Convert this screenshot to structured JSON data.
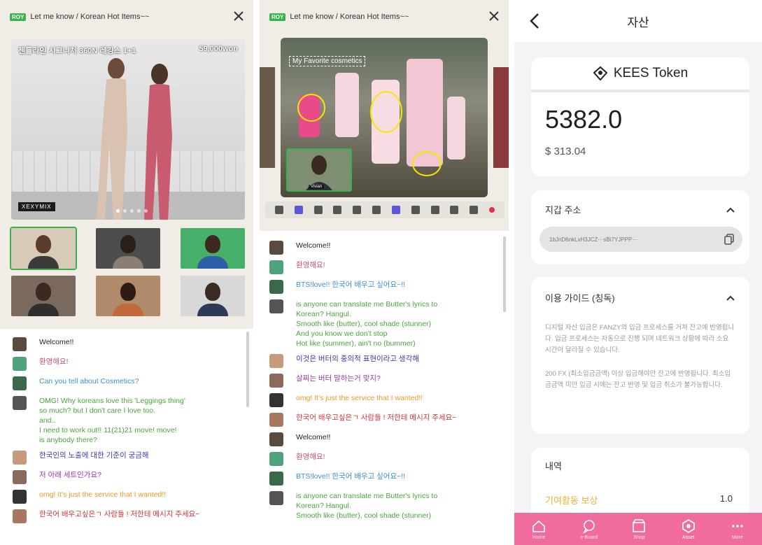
{
  "stream": {
    "badge": "ROY",
    "title": "Let me know / Korean Hot Items~~",
    "video_caption": "젠틀라인 시그니처 360N 레깅스 1+1",
    "price": "59,000won",
    "brand": "XEXYMIX",
    "pip_name": "Vivian",
    "highlight_label": "My Favorite cosmetics"
  },
  "chat1": [
    {
      "text": "Welcome!!",
      "color": "#222222",
      "avatar": "#5b4a3e"
    },
    {
      "text": "환영해요!",
      "color": "#d2536e",
      "avatar": "#4fa27a"
    },
    {
      "text": "Can you tell about Cosmetics?",
      "color": "#3f8fc9",
      "avatar": "#3b6a4b"
    },
    {
      "text": "OMG! Why koreans love this 'Leggings thing'\nso much? but I don't care I love too.\nand..\nI need to work out!! 11(21)21 move! move!\nis anybody there?",
      "color": "#4aa63c",
      "avatar": "#555555"
    },
    {
      "text": "한국인의 노출에 대한 기준이 궁금해",
      "color": "#3a3ab0",
      "avatar": "#c69a7a"
    },
    {
      "text": "저 아래 세트인가요?",
      "color": "#9a3aa8",
      "avatar": "#8a6a5a"
    },
    {
      "text": "omg! It's just the service that I wanted!!",
      "color": "#e59a2a",
      "avatar": "#333333"
    },
    {
      "text": "한국어 배우고싶은ㄱ 사람들 ! 저한테 메시지 주세요~",
      "color": "#d2363a",
      "avatar": "#a77760"
    }
  ],
  "chat2": [
    {
      "text": "Welcome!!",
      "color": "#222222",
      "avatar": "#5b4a3e"
    },
    {
      "text": "환영해요!",
      "color": "#d2536e",
      "avatar": "#4fa27a"
    },
    {
      "text": "BTS!love!! 한국어 배우고 싶어요~!!",
      "color": "#3f8fc9",
      "avatar": "#3b6a4b"
    },
    {
      "text": "is anyone can translate me Butter's lyrics to\nKorean? Hangul.\nSmooth like (butter), cool shade (stunner)\nAnd you know we don't stop\nHot like (summer), ain't no (bummer)",
      "color": "#4aa63c",
      "avatar": "#555555"
    },
    {
      "text": "이것은 버터의 중의적 표현이라고 생각해",
      "color": "#3a3ab0",
      "avatar": "#c69a7a"
    },
    {
      "text": "살찌는 버터 말하는거 맞지?",
      "color": "#9a3aa8",
      "avatar": "#8a6a5a"
    },
    {
      "text": "omg! It's just the service that I wanted!!",
      "color": "#e59a2a",
      "avatar": "#333333"
    },
    {
      "text": "한국어 배우고싶은ㄱ 사람들 ! 저한테 메시지 주세요~",
      "color": "#d2363a",
      "avatar": "#a77760"
    },
    {
      "text": "Welcome!!",
      "color": "#222222",
      "avatar": "#5b4a3e"
    },
    {
      "text": "환영해요!",
      "color": "#d2536e",
      "avatar": "#4fa27a"
    },
    {
      "text": "BTS!love!! 한국어 배우고 싶어요~!!",
      "color": "#3f8fc9",
      "avatar": "#3b6a4b"
    },
    {
      "text": "is anyone can translate me Butter's lyrics to\nKorean? Hangul.\nSmooth like (butter), cool shade (stunner)",
      "color": "#4aa63c",
      "avatar": "#555555"
    }
  ],
  "wallet": {
    "title": "자산",
    "token_name": "KEES Token",
    "amount": "5382.0",
    "usd": "$ 313.04",
    "address_title": "지갑 주소",
    "address": "1bJnD6nkLxH3JCZ···sBi7YJPPP···",
    "guide_title": "이용 가이드 (칭독)",
    "guide_p1": "디지털 자산 입금은 FANZY의 입금 프로세스를 거쳐 잔고에 반영됩니다. 입금 프로세스는 자동으로 진행 되며 네트워크 상황에 따라 소요 시간이 달라질 수 있습니다.",
    "guide_p2": "200 FX (최소입금금액) 이상 입금해야만 잔고에 반영됩니다. 최소입금금액 미만 입금 시에는 잔고 반영 및 입금 취소가 불가능합니다.",
    "history_title": "내역",
    "history_label": "기여활동 보상",
    "history_value": "1.0",
    "accent": "#f06b9e",
    "nav": [
      "Home",
      "e-Board",
      "Shop",
      "Asset",
      "More"
    ]
  }
}
